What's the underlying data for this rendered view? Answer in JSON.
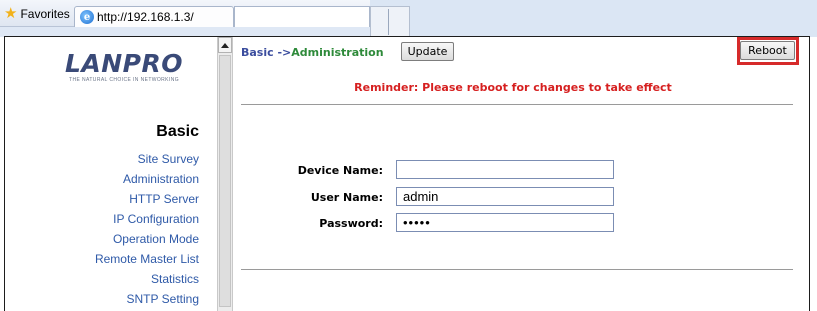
{
  "browser": {
    "favorites_label": "Favorites",
    "tab_url": "http://192.168.1.3/",
    "star_icon": "favorites-star-icon",
    "page_icon": "ie-icon"
  },
  "sidebar": {
    "logo_text": "LANPRO",
    "logo_tagline": "THE NATURAL CHOICE IN NETWORKING",
    "section_title": "Basic",
    "items": [
      {
        "label": "Site Survey"
      },
      {
        "label": "Administration"
      },
      {
        "label": "HTTP Server"
      },
      {
        "label": "IP Configuration"
      },
      {
        "label": "Operation Mode"
      },
      {
        "label": "Remote Master List"
      },
      {
        "label": "Statistics"
      },
      {
        "label": "SNTP Setting"
      }
    ]
  },
  "main": {
    "breadcrumb_prefix": "Basic ->",
    "breadcrumb_current": "Administration",
    "update_label": "Update",
    "reboot_label": "Reboot",
    "reminder": "Reminder: Please reboot for changes to take effect",
    "form": {
      "device_name_label": "Device Name:",
      "device_name_value": "",
      "user_name_label": "User Name:",
      "user_name_value": "admin",
      "password_label": "Password:",
      "password_value": "•••••"
    }
  },
  "colors": {
    "nav_link": "#2f5aa8",
    "breadcrumb": "#3b4d9e",
    "breadcrumb_current": "#2e8a3a",
    "reminder": "#d62020",
    "highlight_box": "#d62a2a"
  }
}
